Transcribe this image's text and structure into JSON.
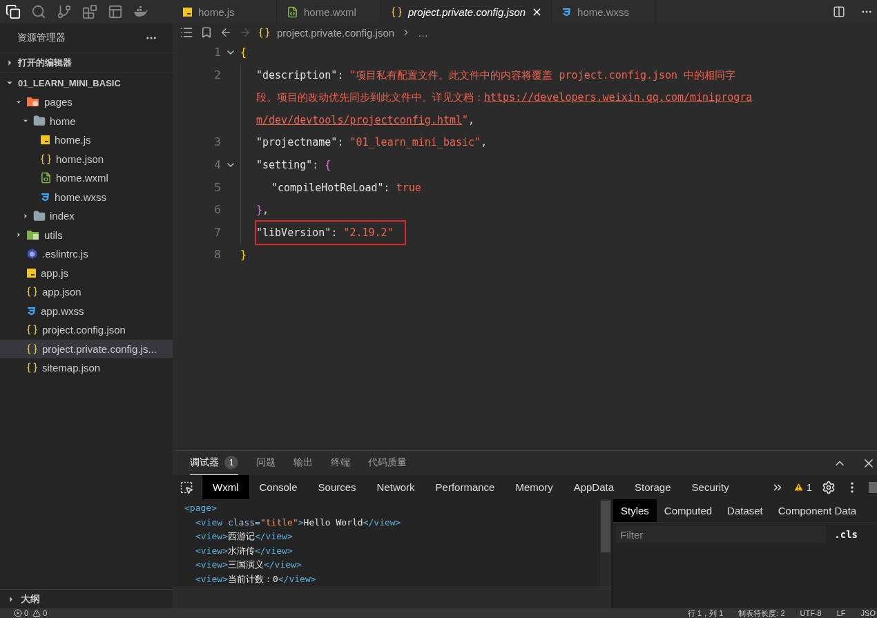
{
  "activity_bar": [
    {
      "kind": "files",
      "selected": true
    },
    {
      "kind": "search",
      "selected": false
    },
    {
      "kind": "branch",
      "selected": false
    },
    {
      "kind": "blocks",
      "selected": false
    },
    {
      "kind": "panel",
      "selected": false
    },
    {
      "kind": "whale",
      "selected": false
    }
  ],
  "tabs": [
    {
      "label": "home.js",
      "kind": "js",
      "selected": false
    },
    {
      "label": "home.wxml",
      "kind": "wxml",
      "selected": false
    },
    {
      "label": "project.private.config.json",
      "kind": "json",
      "selected": true
    },
    {
      "label": "home.wxss",
      "kind": "wxss",
      "selected": false
    }
  ],
  "sidebar": {
    "title": "资源管理器",
    "sections": [
      {
        "label": "打开的编辑器",
        "expanded": false
      },
      {
        "label": "01_LEARN_MINI_BASIC",
        "expanded": true
      }
    ],
    "tree": [
      {
        "label": "pages",
        "kind": "pagesfolder",
        "expanded": true,
        "selected": false,
        "children": [
          {
            "label": "home",
            "kind": "folder",
            "expanded": true,
            "selected": false,
            "children": [
              {
                "label": "home.js",
                "kind": "js",
                "selected": false
              },
              {
                "label": "home.json",
                "kind": "json",
                "selected": false
              },
              {
                "label": "home.wxml",
                "kind": "wxml",
                "selected": false
              },
              {
                "label": "home.wxss",
                "kind": "wxss",
                "selected": false
              }
            ]
          },
          {
            "label": "index",
            "kind": "folder",
            "expanded": false,
            "selected": false
          }
        ]
      },
      {
        "label": "utils",
        "kind": "utilsfolder",
        "expanded": false,
        "selected": false
      },
      {
        "label": ".eslintrc.js",
        "kind": "eslint",
        "selected": false
      },
      {
        "label": "app.js",
        "kind": "js",
        "selected": false
      },
      {
        "label": "app.json",
        "kind": "json",
        "selected": false
      },
      {
        "label": "app.wxss",
        "kind": "wxss",
        "selected": false
      },
      {
        "label": "project.config.json",
        "kind": "json",
        "selected": false
      },
      {
        "label": "project.private.config.js...",
        "kind": "json",
        "selected": true
      },
      {
        "label": "sitemap.json",
        "kind": "json",
        "selected": false
      }
    ],
    "outline": {
      "label": "大纲",
      "expanded": false
    }
  },
  "breadcrumb": {
    "file": "project.private.config.json",
    "rest": "…"
  },
  "code": [
    {
      "number": "1",
      "fold": true,
      "boxed": false,
      "tokens": [
        {
          "kind": "brace",
          "text": "{"
        }
      ],
      "children": [
        {
          "number": "2",
          "fold": false,
          "boxed": false,
          "tokens": [
            {
              "kind": "key",
              "text": "\"description\""
            },
            {
              "kind": "punct",
              "text": ": "
            },
            {
              "kind": "string",
              "text": "\"项目私有配置文件。此文件中的内容将覆盖 project.config.json 中的相同字段。项目的改动优先同步到此文件中。详见文档："
            },
            {
              "kind": "link",
              "text": "https://developers.weixin.qq.com/miniprogram/dev/devtools/projectconfig.html"
            },
            {
              "kind": "string",
              "text": "\""
            },
            {
              "kind": "punct",
              "text": ","
            }
          ]
        },
        {
          "number": "3",
          "fold": false,
          "boxed": false,
          "tokens": [
            {
              "kind": "key",
              "text": "\"projectname\""
            },
            {
              "kind": "punct",
              "text": ": "
            },
            {
              "kind": "string",
              "text": "\"01_learn_mini_basic\""
            },
            {
              "kind": "punct",
              "text": ","
            }
          ]
        },
        {
          "number": "4",
          "fold": true,
          "boxed": false,
          "tokens": [
            {
              "kind": "key",
              "text": "\"setting\""
            },
            {
              "kind": "punct",
              "text": ": "
            },
            {
              "kind": "subbrace",
              "text": "{"
            }
          ],
          "children": [
            {
              "number": "5",
              "fold": false,
              "boxed": false,
              "tokens": [
                {
                  "kind": "key",
                  "text": "\"compileHotReLoad\""
                },
                {
                  "kind": "punct",
                  "text": ": "
                },
                {
                  "kind": "bool",
                  "text": "true"
                }
              ]
            }
          ]
        },
        {
          "number": "6",
          "fold": false,
          "boxed": false,
          "tokens": [
            {
              "kind": "subbrace",
              "text": "}"
            },
            {
              "kind": "punct",
              "text": ","
            }
          ]
        },
        {
          "number": "7",
          "fold": false,
          "boxed": true,
          "tokens": [
            {
              "kind": "key",
              "text": "\"libVersion\""
            },
            {
              "kind": "punct",
              "text": ": "
            },
            {
              "kind": "string",
              "text": "\"2.19.2\""
            }
          ]
        }
      ]
    },
    {
      "number": "8",
      "fold": false,
      "boxed": false,
      "tokens": [
        {
          "kind": "brace",
          "text": "}"
        }
      ]
    }
  ],
  "panel": {
    "tabs": [
      {
        "label": "调试器",
        "badge": "1",
        "selected": true
      },
      {
        "label": "问题",
        "selected": false
      },
      {
        "label": "输出",
        "selected": false
      },
      {
        "label": "终端",
        "selected": false
      },
      {
        "label": "代码质量",
        "selected": false
      }
    ]
  },
  "devtools": {
    "tabs": [
      {
        "label": "Wxml",
        "selected": true
      },
      {
        "label": "Console",
        "selected": false
      },
      {
        "label": "Sources",
        "selected": false
      },
      {
        "label": "Network",
        "selected": false
      },
      {
        "label": "Performance",
        "selected": false
      },
      {
        "label": "Memory",
        "selected": false
      },
      {
        "label": "AppData",
        "selected": false
      },
      {
        "label": "Storage",
        "selected": false
      },
      {
        "label": "Security",
        "selected": false
      }
    ],
    "warnings": "1",
    "wxml": [
      {
        "tokens": [
          {
            "kind": "tag",
            "text": "<page>"
          }
        ],
        "children": [
          {
            "tokens": [
              {
                "kind": "tag",
                "text": "<view "
              },
              {
                "kind": "attr",
                "text": "class="
              },
              {
                "kind": "value",
                "text": "\"title\""
              },
              {
                "kind": "tag",
                "text": ">"
              },
              {
                "kind": "text",
                "text": "Hello World"
              },
              {
                "kind": "tag",
                "text": "</view>"
              }
            ]
          },
          {
            "tokens": [
              {
                "kind": "tag",
                "text": "<view>"
              },
              {
                "kind": "text",
                "text": "西游记"
              },
              {
                "kind": "tag",
                "text": "</view>"
              }
            ]
          },
          {
            "tokens": [
              {
                "kind": "tag",
                "text": "<view>"
              },
              {
                "kind": "text",
                "text": "水浒传"
              },
              {
                "kind": "tag",
                "text": "</view>"
              }
            ]
          },
          {
            "tokens": [
              {
                "kind": "tag",
                "text": "<view>"
              },
              {
                "kind": "text",
                "text": "三国演义"
              },
              {
                "kind": "tag",
                "text": "</view>"
              }
            ]
          },
          {
            "tokens": [
              {
                "kind": "tag",
                "text": "<view>"
              },
              {
                "kind": "text",
                "text": "当前计数：0"
              },
              {
                "kind": "tag",
                "text": "</view>"
              }
            ]
          }
        ]
      }
    ],
    "style_tabs": [
      {
        "label": "Styles",
        "selected": true
      },
      {
        "label": "Computed",
        "selected": false
      },
      {
        "label": "Dataset",
        "selected": false
      },
      {
        "label": "Component Data",
        "selected": false
      }
    ],
    "filter": {
      "placeholder": "Filter"
    },
    "cls": ".cls"
  },
  "status_bar": {
    "errors": "0",
    "warnings": "0",
    "items": [
      "行 1，列 1",
      "制表符长度: 2",
      "UTF-8",
      "LF",
      "JSO"
    ]
  }
}
